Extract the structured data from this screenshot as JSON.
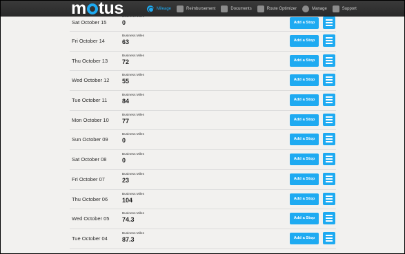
{
  "app": {
    "logo_text": "motus"
  },
  "nav": [
    {
      "label": "Mileage",
      "icon": "mileage-gauge-icon",
      "active": true
    },
    {
      "label": "Reimbursement",
      "icon": "reimbursement-icon",
      "active": false
    },
    {
      "label": "Documents",
      "icon": "documents-icon",
      "active": false
    },
    {
      "label": "Route Optimizer",
      "icon": "route-optimizer-icon",
      "active": false
    },
    {
      "label": "Manage",
      "icon": "gear-icon",
      "active": false
    },
    {
      "label": "Support",
      "icon": "help-icon",
      "active": false
    }
  ],
  "row_labels": {
    "business_miles": "Business Miles",
    "add_stop": "Add a Stop"
  },
  "days": [
    {
      "date": "Sat October 15",
      "miles": "0"
    },
    {
      "date": "Fri October 14",
      "miles": "63"
    },
    {
      "date": "Thu October 13",
      "miles": "72"
    },
    {
      "date": "Wed October 12",
      "miles": "55"
    },
    {
      "date": "Tue October 11",
      "miles": "84"
    },
    {
      "date": "Mon October 10",
      "miles": "77"
    },
    {
      "date": "Sun October 09",
      "miles": "0"
    },
    {
      "date": "Sat October 08",
      "miles": "0"
    },
    {
      "date": "Fri October 07",
      "miles": "23"
    },
    {
      "date": "Thu October 06",
      "miles": "104"
    },
    {
      "date": "Wed October 05",
      "miles": "74.3"
    },
    {
      "date": "Tue October 04",
      "miles": "87.3"
    }
  ],
  "colors": {
    "accent": "#1eaaf1",
    "topbar": "#2f2f2f",
    "background": "#f2f1ef"
  }
}
